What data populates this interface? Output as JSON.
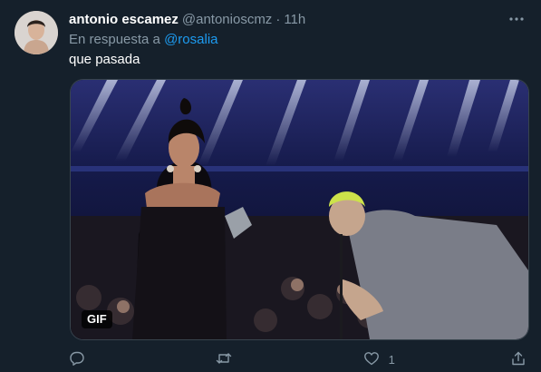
{
  "tweet": {
    "display_name": "antonio escamez",
    "handle": "@antonioscmz",
    "separator": "·",
    "time": "11h",
    "reply_prefix": "En respuesta a",
    "reply_to": "@rosalia",
    "text": "que pasada",
    "media_badge": "GIF"
  },
  "actions": {
    "reply_count": "",
    "retweet_count": "",
    "like_count": "1",
    "icons": [
      "reply-icon",
      "retweet-icon",
      "like-icon",
      "share-icon"
    ]
  },
  "colors": {
    "background": "#15202b",
    "secondary_text": "#8899a6",
    "accent": "#1d9bf0"
  }
}
